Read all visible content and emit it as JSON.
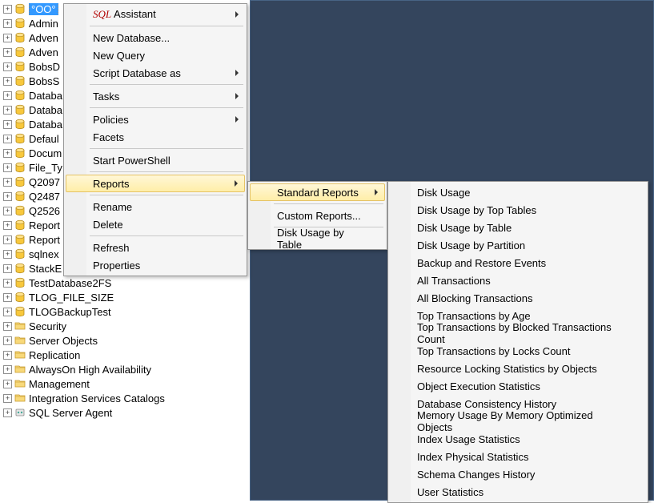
{
  "tree": {
    "databases": [
      "°OO°",
      "Admin",
      "Adven",
      "Adven",
      "BobsD",
      "BobsS",
      "Databa",
      "Databa",
      "Databa",
      "Defaul",
      "Docum",
      "File_Ty",
      "Q2097",
      "Q2487",
      "Q2526",
      "Report",
      "Report",
      "sqlnex",
      "StackE",
      "TestDatabase2FS",
      "TLOG_FILE_SIZE",
      "TLOGBackupTest"
    ],
    "folders": [
      "Security",
      "Server Objects",
      "Replication",
      "AlwaysOn High Availability",
      "Management",
      "Integration Services Catalogs"
    ],
    "agent": "SQL Server Agent"
  },
  "contextMenu": {
    "sql_prefix": "SQL",
    "assistant_suffix": " Assistant",
    "new_database": "New Database...",
    "new_query": "New Query",
    "script_database_as": "Script Database as",
    "tasks": "Tasks",
    "policies": "Policies",
    "facets": "Facets",
    "start_powershell": "Start PowerShell",
    "reports": "Reports",
    "rename": "Rename",
    "delete": "Delete",
    "refresh": "Refresh",
    "properties": "Properties"
  },
  "reportsSubmenu": {
    "standard_reports": "Standard Reports",
    "custom_reports": "Custom Reports...",
    "disk_usage_by_table": "Disk Usage by Table"
  },
  "standardReports": [
    "Disk Usage",
    "Disk Usage by Top Tables",
    "Disk Usage by Table",
    "Disk Usage by Partition",
    "Backup and Restore Events",
    "All Transactions",
    "All Blocking Transactions",
    "Top Transactions by Age",
    "Top Transactions by Blocked Transactions Count",
    "Top Transactions by Locks Count",
    "Resource Locking Statistics by Objects",
    "Object Execution Statistics",
    "Database Consistency History",
    "Memory Usage By Memory Optimized Objects",
    "Index Usage Statistics",
    "Index Physical Statistics",
    "Schema Changes History",
    "User Statistics"
  ]
}
